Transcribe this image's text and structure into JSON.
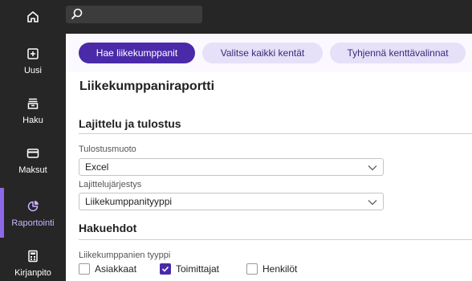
{
  "nav": {
    "home_icon": "home-icon",
    "search_icon": "search-icon",
    "items": [
      {
        "label": "Uusi",
        "icon": "plus-square-icon"
      },
      {
        "label": "Haku",
        "icon": "archive-icon"
      },
      {
        "label": "Maksut",
        "icon": "credit-card-icon"
      },
      {
        "label": "Raportointi",
        "icon": "pie-chart-icon",
        "active": true
      },
      {
        "label": "Kirjanpito",
        "icon": "calculator-icon"
      }
    ]
  },
  "toolbar": {
    "fetch_label": "Hae liikekumppanit",
    "select_all_label": "Valitse kaikki kentät",
    "clear_label": "Tyhjennä kenttävalinnat"
  },
  "page": {
    "title": "Liikekumppaniraportti"
  },
  "sort_section": {
    "heading": "Lajittelu ja tulostus",
    "output_format": {
      "label": "Tulostusmuoto",
      "value": "Excel"
    },
    "sort_order": {
      "label": "Lajittelujärjestys",
      "value": "Liikekumppanityyppi"
    }
  },
  "criteria_section": {
    "heading": "Hakuehdot",
    "type_label": "Liikekumppanien tyyppi",
    "options": [
      {
        "label": "Asiakkaat",
        "checked": false
      },
      {
        "label": "Toimittajat",
        "checked": true
      },
      {
        "label": "Henkilöt",
        "checked": false
      }
    ]
  },
  "colors": {
    "sidebar": "#262626",
    "accent": "#4a2aa8",
    "active_nav": "#c9b3ff"
  }
}
